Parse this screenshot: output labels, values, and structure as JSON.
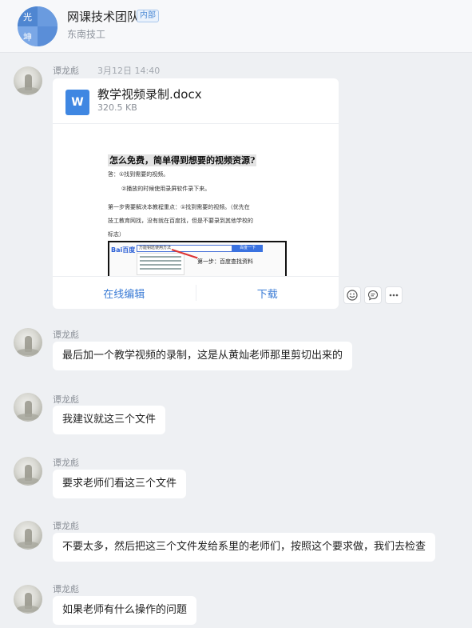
{
  "group": {
    "avatar_chars": [
      "光",
      "",
      "坤",
      ""
    ],
    "title": "网课技术团队",
    "badge": "内部",
    "subtitle": "东南技工"
  },
  "messages": [
    {
      "sender": "谭龙彪",
      "time": "3月12日 14:40",
      "file": {
        "icon_letter": "W",
        "name": "教学视频录制.docx",
        "size": "320.5 KB",
        "preview": {
          "title": "怎么免费，简单得到想要的视频资源?",
          "lines": [
            "答：①找到需要的视频。",
            "②播放的时候使用录屏软件录下来。",
            "第一步需要解决本教程重点：①找到需要的视频。（优先在",
            "技工教育网找，没有就在百度找，但是不要录到其他学校的",
            "标志）"
          ],
          "screenshot": {
            "logo": "Bai百度",
            "search_text": "万能钥匙使用方法",
            "button_text": "百度一下",
            "step_text": "第一步：百度查找资料"
          }
        },
        "actions": [
          "在线编辑",
          "下载"
        ]
      }
    },
    {
      "sender": "谭龙彪",
      "text": "最后加一个教学视频的录制，这是从黄灿老师那里剪切出来的"
    },
    {
      "sender": "谭龙彪",
      "text": "我建议就这三个文件"
    },
    {
      "sender": "谭龙彪",
      "text": "要求老师们看这三个文件"
    },
    {
      "sender": "谭龙彪",
      "text": "不要太多，然后把这三个文件发给系里的老师们，按照这个要求做，我们去检查"
    },
    {
      "sender": "谭龙彪",
      "text": "如果老师有什么操作的问题"
    }
  ],
  "message_tools": [
    "emoji-icon",
    "reply-icon",
    "more-icon"
  ],
  "colors": {
    "background": "#eef0f3",
    "accent": "#3a7bd5",
    "word_icon": "#3f87e2"
  }
}
